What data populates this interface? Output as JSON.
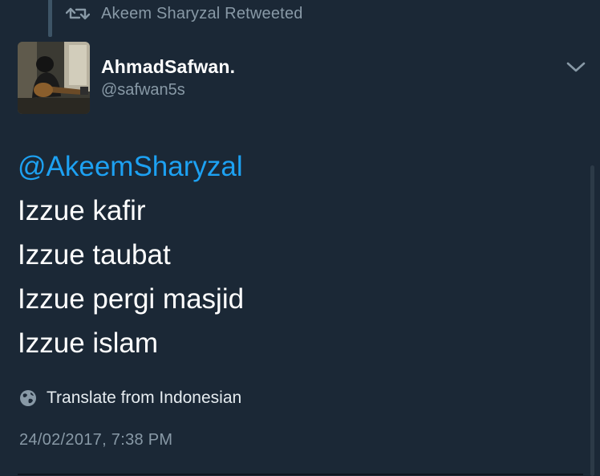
{
  "retweet": {
    "icon": "retweet-icon",
    "text": "Akeem Sharyzal Retweeted"
  },
  "author": {
    "name": "AhmadSafwan.",
    "handle": "@safwan5s"
  },
  "menu": {
    "icon": "chevron-down-icon"
  },
  "tweet": {
    "mention": "@AkeemSharyzal",
    "lines": [
      "Izzue kafir",
      "Izzue taubat",
      "Izzue pergi masjid",
      "Izzue islam"
    ]
  },
  "translate": {
    "icon": "globe-icon",
    "label": "Translate from Indonesian"
  },
  "timestamp": "24/02/2017, 7:38 PM",
  "colors": {
    "background": "#1b2836",
    "mention": "#1da1f2",
    "secondary_text": "#8899a6",
    "primary_text": "#ffffff"
  }
}
